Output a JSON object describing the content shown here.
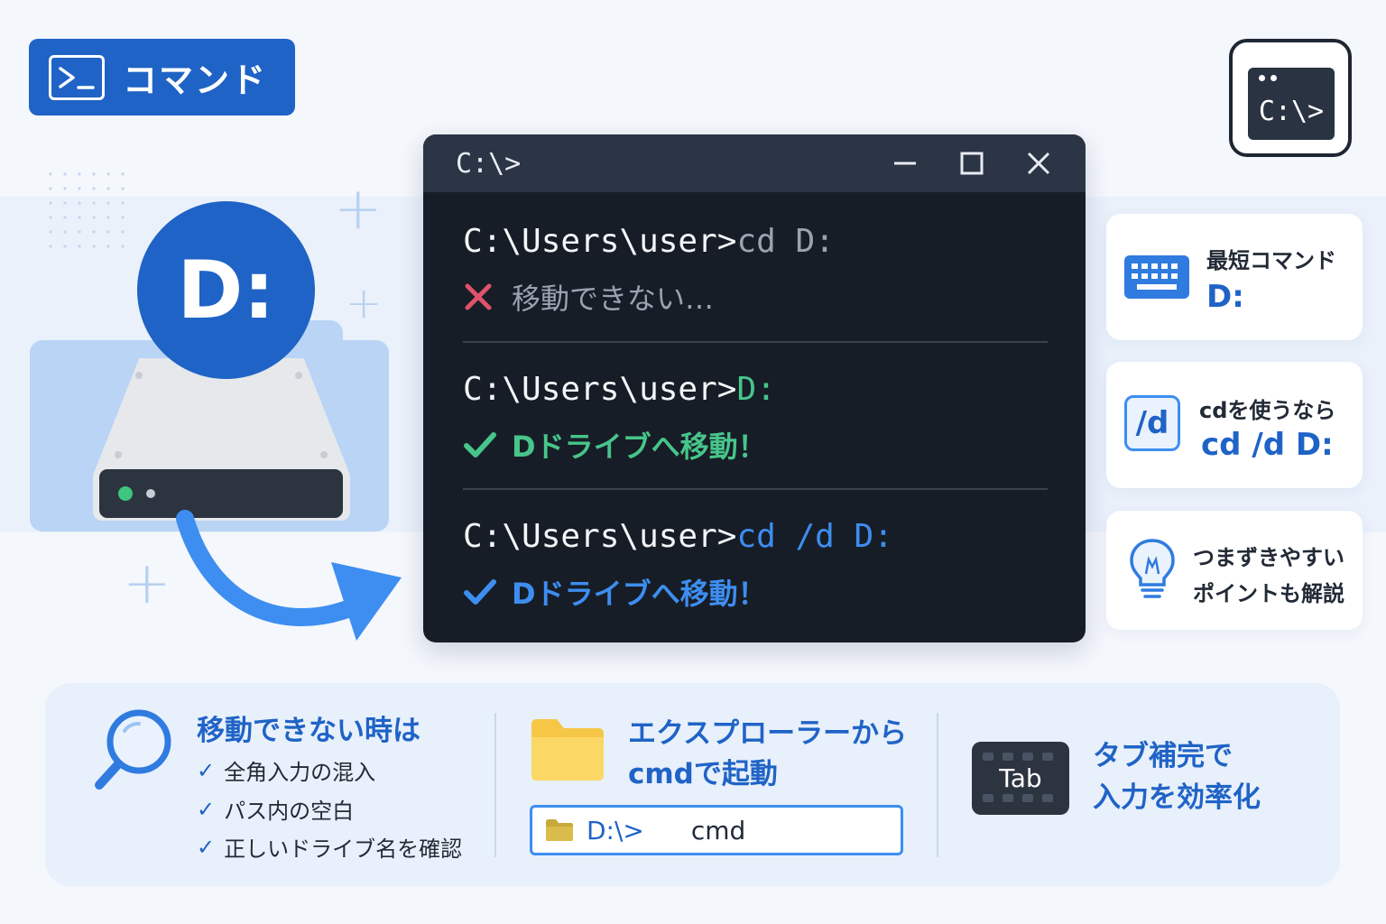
{
  "badge": {
    "label": "コマンド",
    "icon": "terminal-icon"
  },
  "corner_prompt": {
    "text": "C:\\>",
    "icon": "command-prompt-icon"
  },
  "drive": {
    "letter": "D:"
  },
  "terminal": {
    "title": "C:\\>",
    "blocks": [
      {
        "prompt": "C:\\Users\\user>",
        "command": "cd D:",
        "result": "移動できない…",
        "status": "fail"
      },
      {
        "prompt": "C:\\Users\\user>",
        "command": "D:",
        "result": "Dドライブへ移動！",
        "status": "ok"
      },
      {
        "prompt": "C:\\Users\\user>",
        "command": "cd /d D:",
        "result": "Dドライブへ移動！",
        "status": "ok-blue"
      }
    ]
  },
  "tips": [
    {
      "label": "最短コマンド",
      "value": "D:",
      "icon": "keyboard-icon"
    },
    {
      "label": "cdを使うなら",
      "value": "cd /d D:",
      "icon": "slash-d-icon",
      "icon_text": "/d"
    },
    {
      "line1": "つまずきやすい",
      "line2": "ポイントも解説",
      "icon": "lightbulb-icon"
    }
  ],
  "bottom": {
    "troubleshoot": {
      "title": "移動できない時は",
      "items": [
        "全角入力の混入",
        "パス内の空白",
        "正しいドライブ名を確認"
      ],
      "icon": "magnifier-icon"
    },
    "explorer": {
      "line1": "エクスプローラーから",
      "line2": "cmdで起動",
      "address_prompt": "D:\\>",
      "address_cmd": "cmd",
      "icon": "folder-icon"
    },
    "tab": {
      "line1": "タブ補完で",
      "line2": "入力を効率化",
      "key_label": "Tab"
    }
  },
  "colors": {
    "accent": "#1f63c6",
    "terminal_bg": "#171d27",
    "ok_green": "#47c58a",
    "ok_blue": "#3d8ef0",
    "fail_red": "#e0526b"
  }
}
